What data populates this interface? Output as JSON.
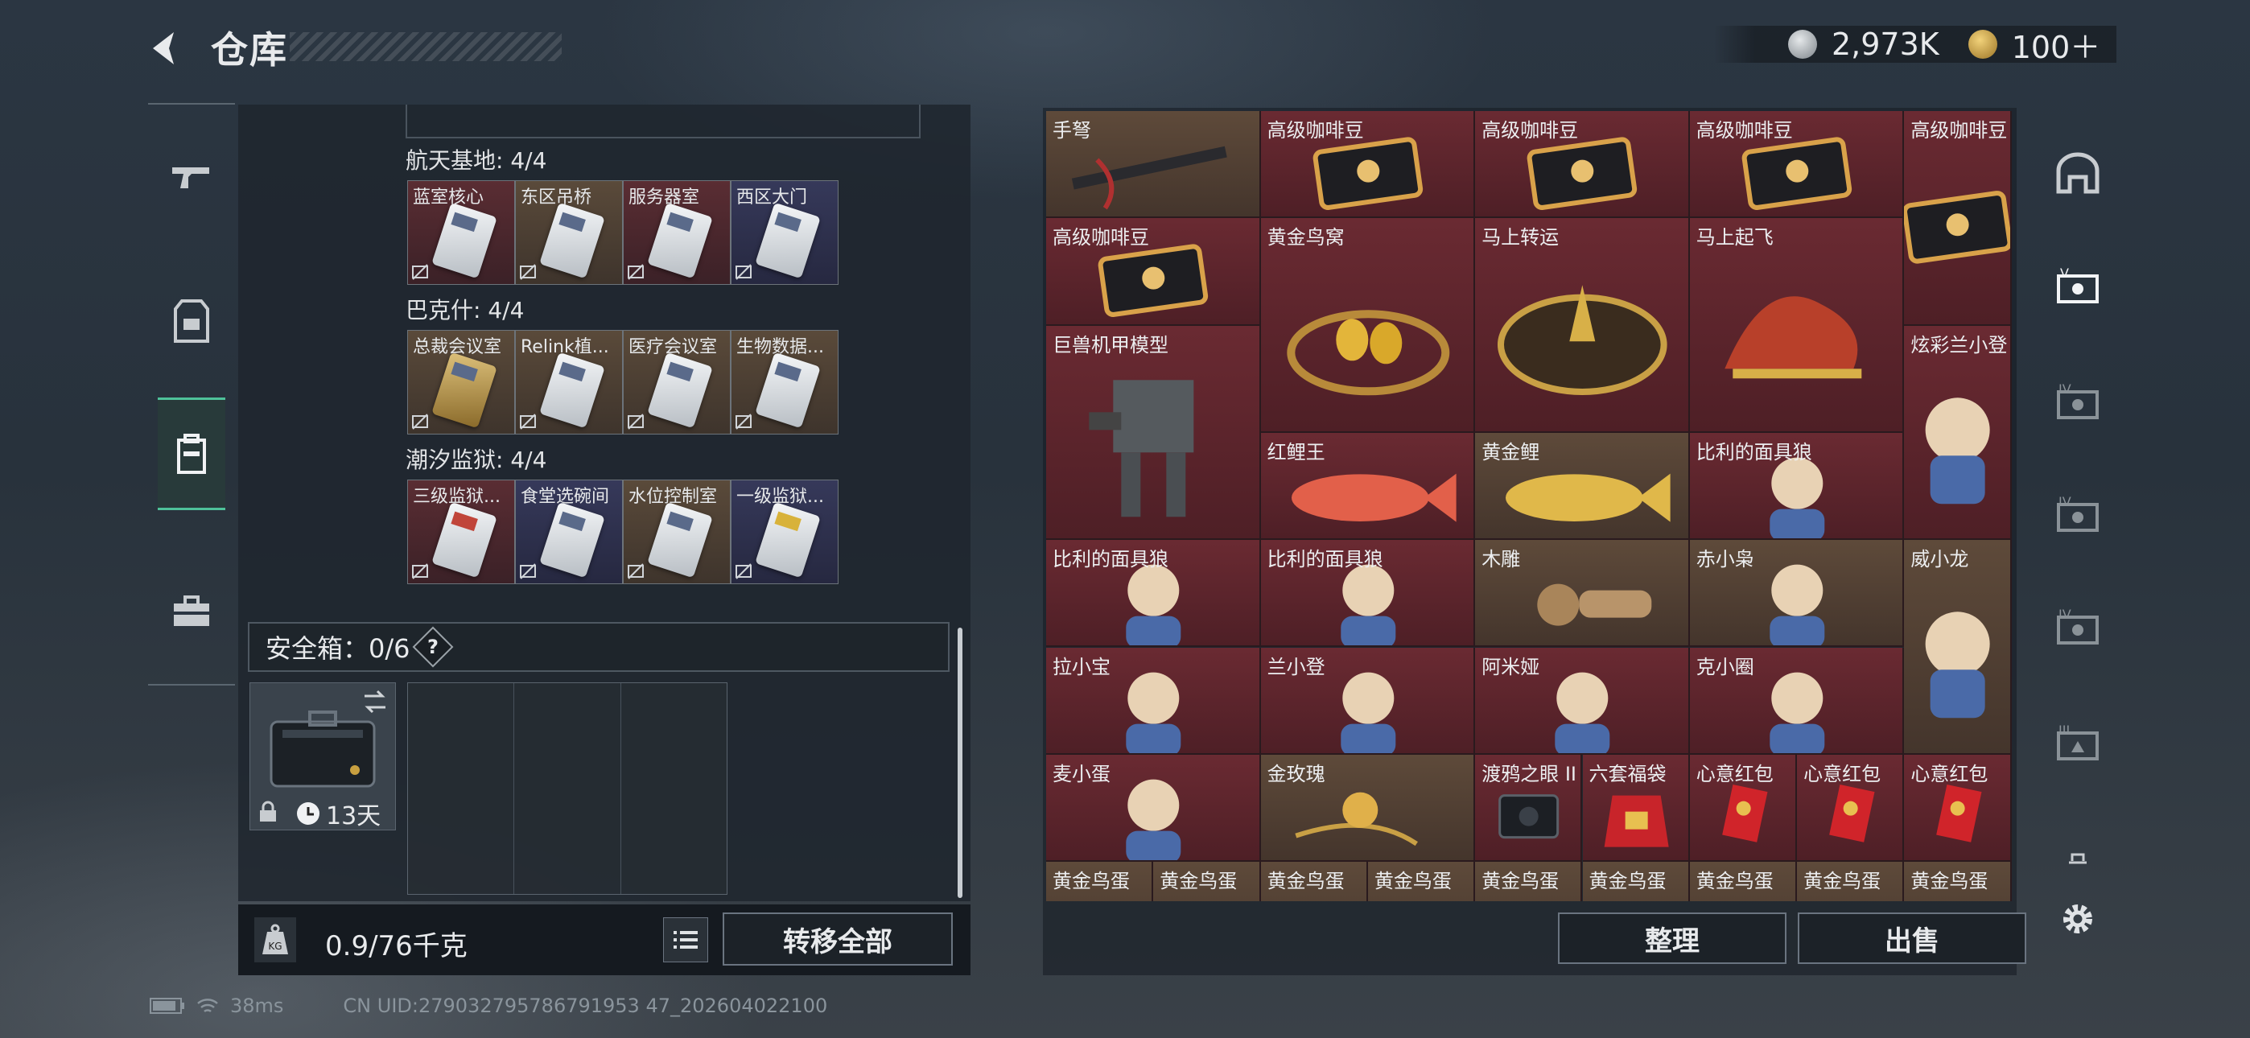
{
  "header": {
    "title": "仓库",
    "back_icon": "back-arrow-icon"
  },
  "currency": {
    "silver": "2,973K",
    "gold": "100＋",
    "silver_icon": "silver-coin-icon",
    "gold_icon": "gold-coin-icon"
  },
  "left_nav": [
    {
      "icon": "gun-icon"
    },
    {
      "icon": "armor-icon"
    },
    {
      "icon": "backpack-icon",
      "active": true
    },
    {
      "icon": "briefcase-icon"
    }
  ],
  "groups": [
    {
      "title": "航天基地: 4/4",
      "cards": [
        {
          "label": "蓝室核心",
          "color": "red"
        },
        {
          "label": "东区吊桥",
          "color": "brown"
        },
        {
          "label": "服务器室",
          "color": "red"
        },
        {
          "label": "西区大门",
          "color": "blue"
        }
      ]
    },
    {
      "title": "巴克什: 4/4",
      "cards": [
        {
          "label": "总裁会议室",
          "color": "brown"
        },
        {
          "label": "Relink植...",
          "color": "brown"
        },
        {
          "label": "医疗会议室",
          "color": "brown"
        },
        {
          "label": "生物数据...",
          "color": "brown"
        }
      ]
    },
    {
      "title": "潮汐监狱: 4/4",
      "cards": [
        {
          "label": "三级监狱...",
          "color": "red"
        },
        {
          "label": "食堂选碗间",
          "color": "blue"
        },
        {
          "label": "水位控制室",
          "color": "brown"
        },
        {
          "label": "一级监狱...",
          "color": "blue"
        }
      ]
    }
  ],
  "safe": {
    "label": "安全箱：0/6",
    "help": "?",
    "days": "13天"
  },
  "footer": {
    "weight": "0.9/76千克",
    "transfer": "转移全部"
  },
  "grid": [
    {
      "name": "手弩",
      "c": "brn"
    },
    {
      "name": "高级咖啡豆",
      "c": "red"
    },
    {
      "name": "高级咖啡豆",
      "c": "red"
    },
    {
      "name": "高级咖啡豆",
      "c": "red"
    },
    {
      "name": "高级咖啡豆",
      "c": "red"
    },
    {
      "name": "高级咖啡豆",
      "c": "red"
    },
    {
      "name": "黄金鸟窝",
      "c": "red"
    },
    {
      "name": "马上转运",
      "c": "red"
    },
    {
      "name": "马上起飞",
      "c": "red"
    },
    {
      "name": "巨兽机甲模型",
      "c": "red"
    },
    {
      "name": "炫彩兰小登",
      "c": "red"
    },
    {
      "name": "红鲤王",
      "c": "red"
    },
    {
      "name": "黄金鲤",
      "c": "brn"
    },
    {
      "name": "比利的面具狼",
      "c": "red"
    },
    {
      "name": "比利的面具狼",
      "c": "red"
    },
    {
      "name": "比利的面具狼",
      "c": "red"
    },
    {
      "name": "木雕",
      "c": "brn"
    },
    {
      "name": "赤小枭",
      "c": "brn"
    },
    {
      "name": "威小龙",
      "c": "brn"
    },
    {
      "name": "拉小宝",
      "c": "red"
    },
    {
      "name": "兰小登",
      "c": "red"
    },
    {
      "name": "阿米娅",
      "c": "red"
    },
    {
      "name": "克小圈",
      "c": "red"
    },
    {
      "name": "麦小蛋",
      "c": "red"
    },
    {
      "name": "金玫瑰",
      "c": "brn"
    },
    {
      "name": "渡鸦之眼 II",
      "c": "red"
    },
    {
      "name": "六套福袋",
      "c": "red"
    },
    {
      "name": "心意红包",
      "c": "red"
    },
    {
      "name": "心意红包",
      "c": "red"
    },
    {
      "name": "心意红包",
      "c": "red"
    },
    {
      "name": "黄金鸟蛋",
      "c": "brn"
    },
    {
      "name": "黄金鸟蛋",
      "c": "brn"
    },
    {
      "name": "黄金鸟蛋",
      "c": "brn"
    },
    {
      "name": "黄金鸟蛋",
      "c": "brn"
    },
    {
      "name": "黄金鸟蛋",
      "c": "brn"
    },
    {
      "name": "黄金鸟蛋",
      "c": "brn"
    },
    {
      "name": "黄金鸟蛋",
      "c": "brn"
    },
    {
      "name": "黄金鸟蛋",
      "c": "brn"
    },
    {
      "name": "黄金鸟蛋",
      "c": "brn"
    }
  ],
  "actions": {
    "sort": "整理",
    "sell": "出售"
  },
  "right_nav": [
    {
      "icon": "base-icon"
    },
    {
      "icon": "level-v-icon"
    },
    {
      "icon": "level-iv-icon"
    },
    {
      "icon": "level-iv-icon"
    },
    {
      "icon": "level-iv-icon"
    },
    {
      "icon": "level-iii-icon"
    },
    {
      "icon": "bell-icon"
    },
    {
      "icon": "settings-gear-icon"
    }
  ],
  "status": {
    "ping": "38ms",
    "uid": "CN UID:279032795786791953 47_202604022100"
  }
}
